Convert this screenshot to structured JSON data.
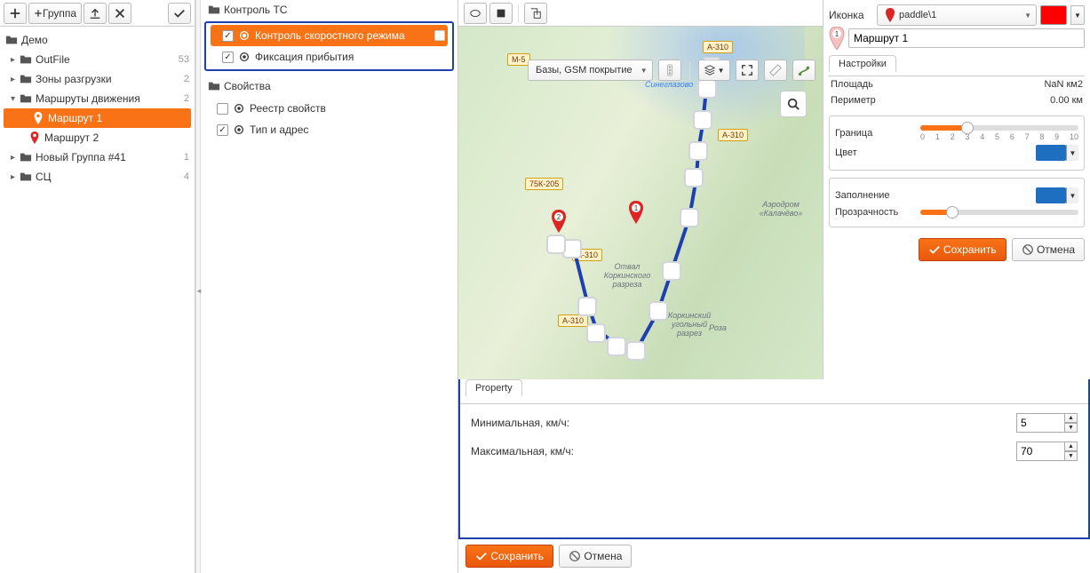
{
  "nav": {
    "toolbar": {
      "addGroup": "Группа"
    },
    "rootLabel": "Демо",
    "items": [
      {
        "label": "OutFile",
        "count": "53",
        "icon": "folder",
        "expanded": false
      },
      {
        "label": "Зоны разгрузки",
        "count": "2",
        "icon": "folder",
        "expanded": false
      },
      {
        "label": "Маршруты движения",
        "count": "2",
        "icon": "folder",
        "expanded": true,
        "children": [
          {
            "label": "Маршрут 1",
            "icon": "pin-orange",
            "selected": true
          },
          {
            "label": "Маршрут 2",
            "icon": "pin-red"
          }
        ]
      },
      {
        "label": "Новый Группа #41",
        "count": "1",
        "icon": "folder",
        "expanded": false
      },
      {
        "label": "СЦ",
        "count": "4",
        "icon": "folder",
        "expanded": false
      }
    ]
  },
  "props": {
    "groupTS": "Контроль ТС",
    "tsItems": [
      {
        "label": "Контроль скоростного режима",
        "checked": true,
        "selected": true
      },
      {
        "label": "Фиксация прибытия",
        "checked": true
      }
    ],
    "groupSv": "Свойства",
    "svItems": [
      {
        "label": "Реестр свойств",
        "checked": false
      },
      {
        "label": "Тип и адрес",
        "checked": true
      }
    ]
  },
  "map": {
    "layers": "Базы, GSM покрытие",
    "roads": {
      "m5": "М-5",
      "a310": "А-310",
      "r75k205": "75К-205"
    },
    "places": {
      "sineglazovo": "Синеглазово",
      "kalachevo": "Аэродром «Калачёво»",
      "korkinskiy": "Коркинский угольный разрез",
      "roza": "Роза",
      "otval": "Отвал Коркинского разреза"
    }
  },
  "rp": {
    "iconLabel": "Иконка",
    "iconValue": "paddle\\1",
    "routeNumber": "1",
    "routeName": "Маршрут 1",
    "settingsTab": "Настройки",
    "areaLabel": "Площадь",
    "areaValue": "NaN км2",
    "perimLabel": "Периметр",
    "perimValue": "0.00 км",
    "borderLabel": "Граница",
    "colorLabel": "Цвет",
    "fillLabel": "Заполнение",
    "opacityLabel": "Прозрачность",
    "sliderTicks": [
      "0",
      "1",
      "2",
      "3",
      "4",
      "5",
      "6",
      "7",
      "8",
      "9",
      "10"
    ],
    "saveBtn": "Сохранить",
    "cancelBtn": "Отмена"
  },
  "property": {
    "tab": "Property",
    "minLabel": "Минимальная, км/ч:",
    "minValue": "5",
    "maxLabel": "Максимальная, км/ч:",
    "maxValue": "70",
    "saveBtn": "Сохранить",
    "cancelBtn": "Отмена"
  }
}
